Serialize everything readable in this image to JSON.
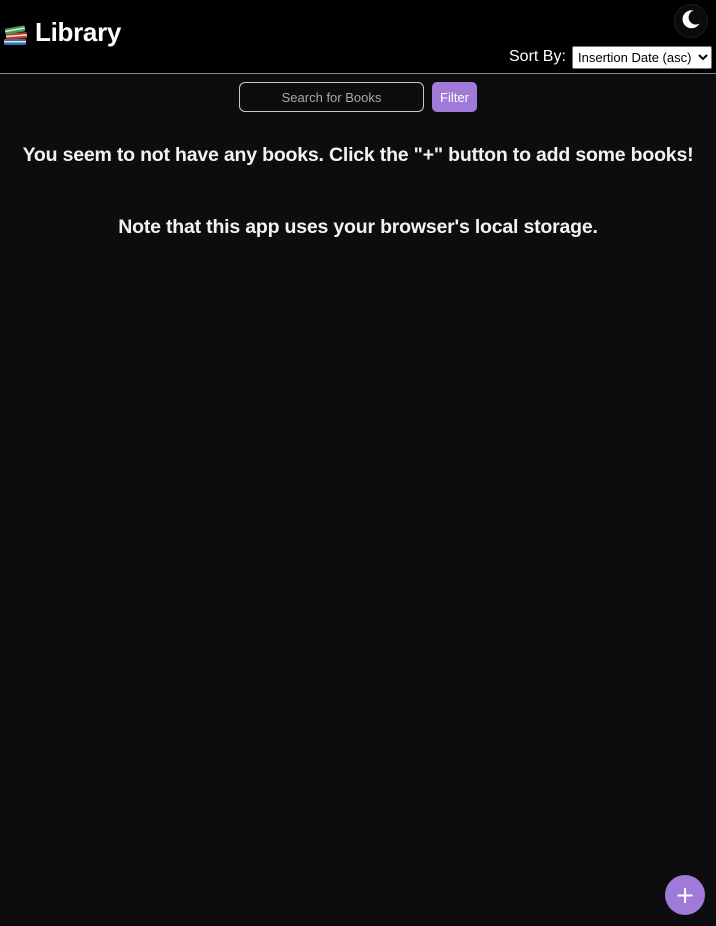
{
  "header": {
    "title": "Library",
    "logo_icon": "books-icon",
    "theme_toggle_icon": "moon-icon",
    "sort_label": "Sort By:",
    "sort_selected": "Insertion Date (asc)"
  },
  "search": {
    "placeholder": "Search for Books",
    "value": "",
    "filter_label": "Filter"
  },
  "main": {
    "empty_message": "You seem to not have any books. Click the \"+\" button to add some books!",
    "storage_note": "Note that this app uses your browser's local storage."
  },
  "fab": {
    "label": "+",
    "icon": "plus-icon"
  },
  "colors": {
    "accent": "#a07ad8",
    "header_bg": "#000000",
    "page_bg": "#0d0d0f"
  }
}
